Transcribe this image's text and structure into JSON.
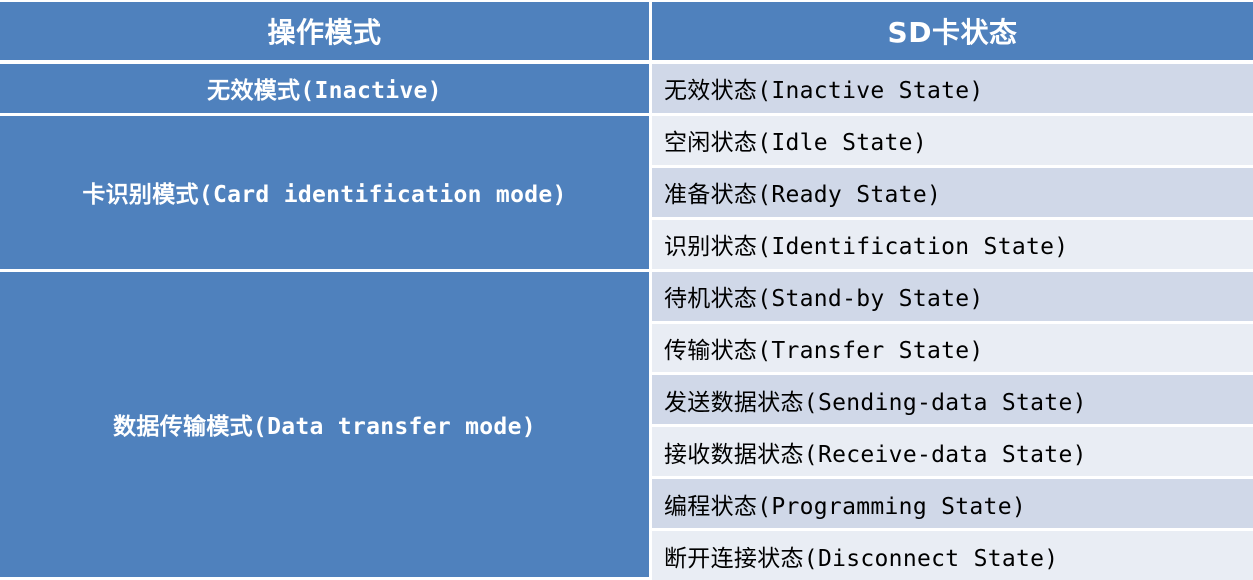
{
  "header": {
    "col_mode": "操作模式",
    "col_state": "SD卡状态"
  },
  "groups": [
    {
      "mode": "无效模式(Inactive)",
      "states": [
        "无效状态(Inactive State)"
      ]
    },
    {
      "mode": "卡识别模式(Card identification mode)",
      "states": [
        "空闲状态(Idle State)",
        "准备状态(Ready State)",
        "识别状态(Identification State)"
      ]
    },
    {
      "mode": "数据传输模式(Data transfer mode)",
      "states": [
        "待机状态(Stand-by State)",
        "传输状态(Transfer State)",
        "发送数据状态(Sending-data State)",
        "接收数据状态(Receive-data State)",
        "编程状态(Programming State)",
        "断开连接状态(Disconnect State)"
      ]
    }
  ],
  "colors": {
    "header_bg": "#4f81bd",
    "mode_bg": "#4f81bd",
    "row_dark": "#d0d8e8",
    "row_light": "#e9edf4"
  }
}
